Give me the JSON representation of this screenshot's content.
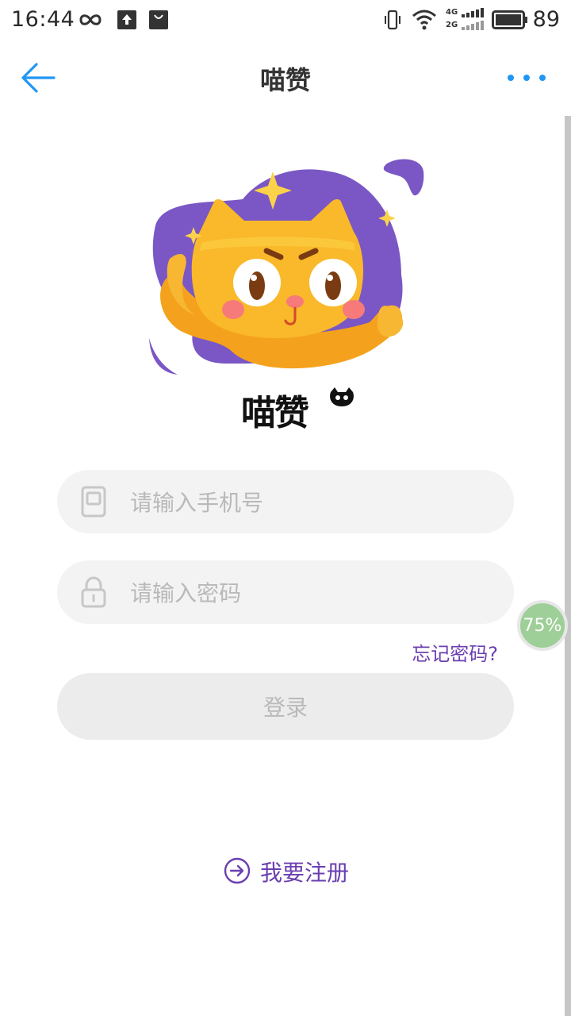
{
  "status_bar": {
    "time": "16:44",
    "battery": "89",
    "network_4g": "4G",
    "network_2g": "2G",
    "icons": [
      "infinity-icon",
      "upload-icon",
      "shopping-bag-icon",
      "vibrate-icon",
      "wifi-icon",
      "signal-icon",
      "battery-icon"
    ]
  },
  "header": {
    "title": "喵赞",
    "back_icon": "arrow-left-icon",
    "more_icon": "more-dots-icon",
    "accent_color": "#2196f3"
  },
  "logo": {
    "wordmark": "喵赞"
  },
  "form": {
    "phone": {
      "placeholder": "请输入手机号",
      "value": "",
      "icon": "phone-icon"
    },
    "password": {
      "placeholder": "请输入密码",
      "value": "",
      "icon": "lock-icon"
    },
    "forgot_label": "忘记密码?",
    "login_label": "登录"
  },
  "register": {
    "label": "我要注册",
    "icon": "arrow-right-circle-icon",
    "color": "#6b3fb0"
  },
  "floating_badge": {
    "text": "75%",
    "progress": 0.75
  }
}
